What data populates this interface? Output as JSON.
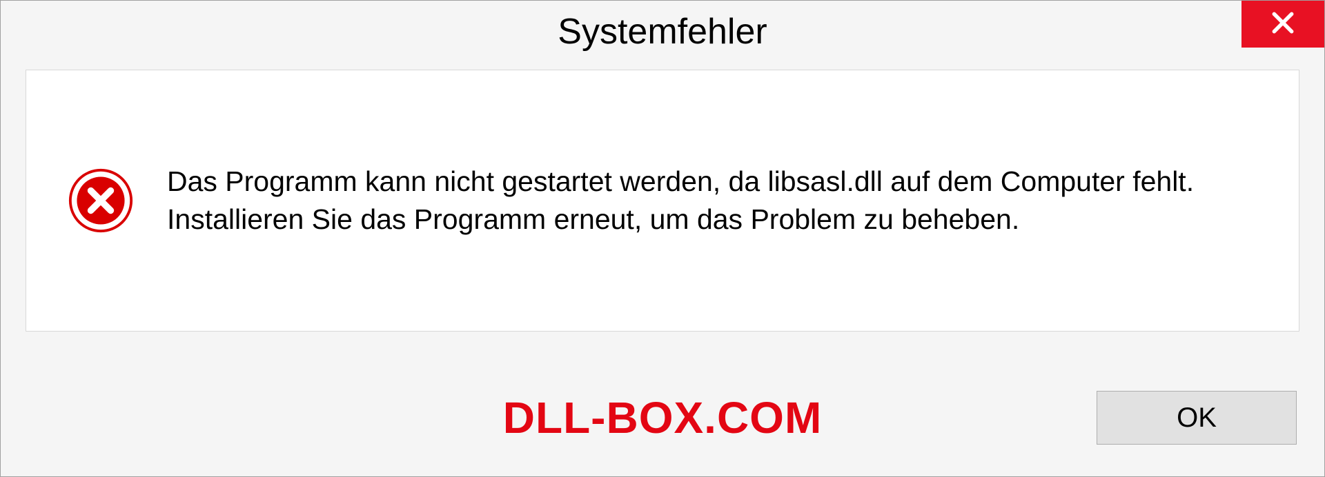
{
  "dialog": {
    "title": "Systemfehler",
    "message": "Das Programm kann nicht gestartet werden, da libsasl.dll auf dem Computer fehlt. Installieren Sie das Programm erneut, um das Problem zu beheben.",
    "ok_label": "OK"
  },
  "watermark": "DLL-BOX.COM",
  "colors": {
    "close_bg": "#e81123",
    "error_icon": "#d90000",
    "watermark": "#e30613"
  }
}
